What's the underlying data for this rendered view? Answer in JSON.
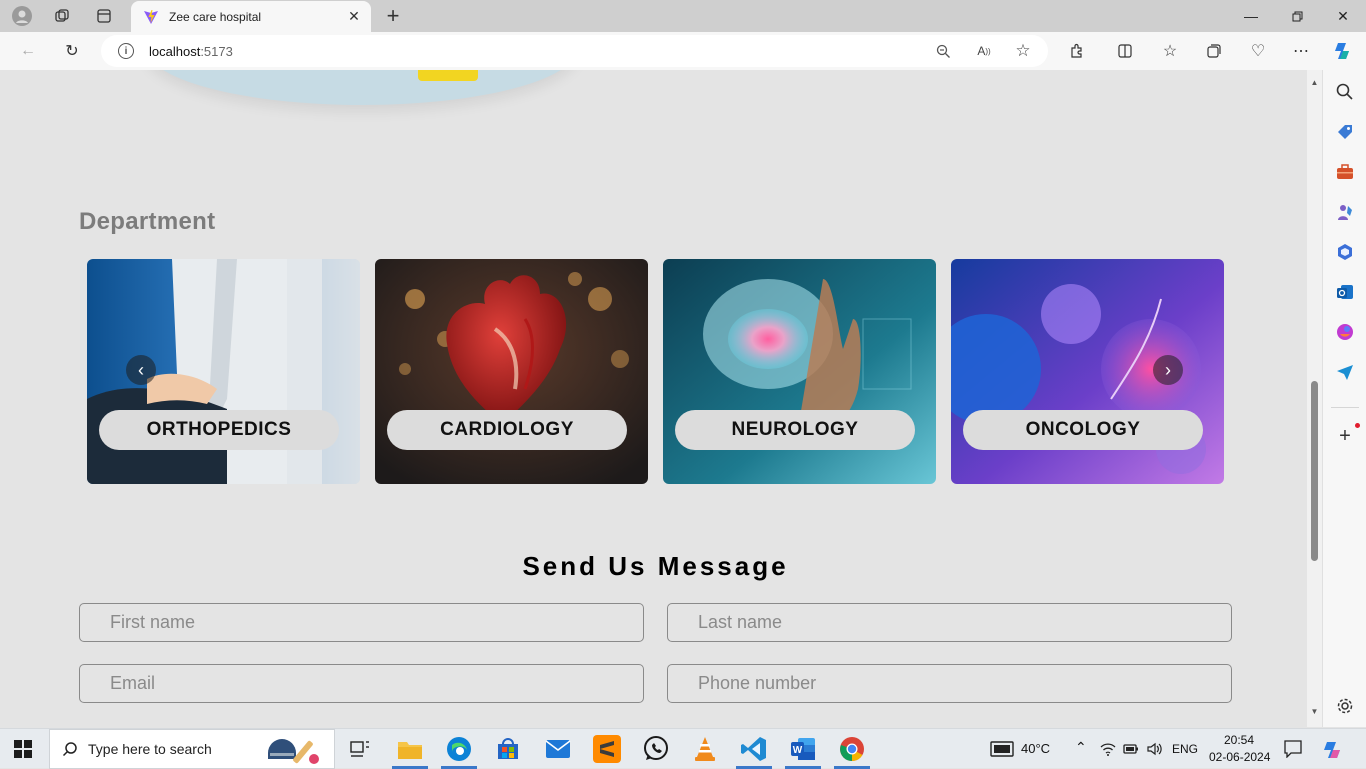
{
  "browser": {
    "tab_title": "Zee care hospital",
    "url_host": "localhost",
    "url_port": ":5173"
  },
  "page": {
    "department_heading": "Department",
    "departments": [
      {
        "name": "ORTHOPEDICS"
      },
      {
        "name": "CARDIOLOGY"
      },
      {
        "name": "NEUROLOGY"
      },
      {
        "name": "ONCOLOGY"
      }
    ],
    "carousel_prev": "‹",
    "carousel_next": "›",
    "message_heading": "Send Us Message",
    "form": {
      "first_name_placeholder": "First name",
      "last_name_placeholder": "Last name",
      "email_placeholder": "Email",
      "phone_placeholder": "Phone number"
    }
  },
  "taskbar": {
    "search_placeholder": "Type here to search",
    "weather": "40°C",
    "language": "ENG",
    "time": "20:54",
    "date": "02-06-2024"
  },
  "colors": {
    "accent": "#3b78c9",
    "page_bg": "#e4e4e4",
    "pill_bg": "#dcdcdc"
  }
}
